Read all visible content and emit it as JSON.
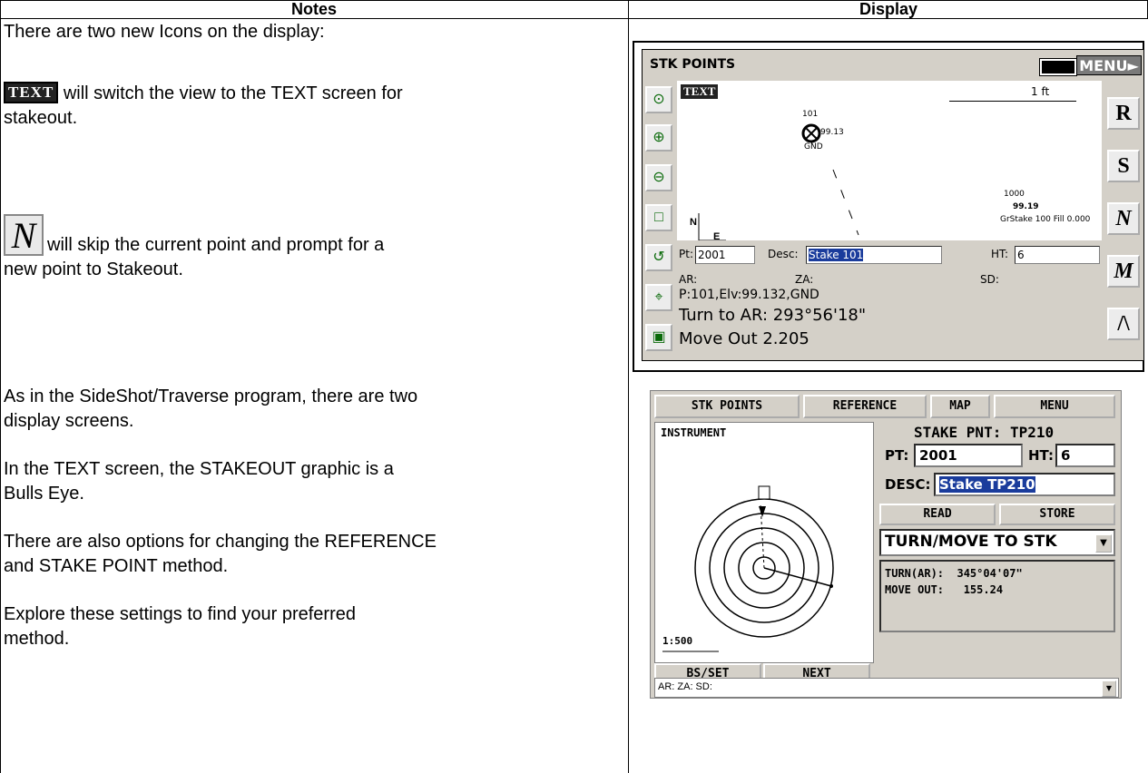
{
  "table": {
    "col_notes": "Notes",
    "col_display": "Display"
  },
  "notes": {
    "line1": "There are two new Icons on the display:",
    "text_icon_label": "TEXT",
    "text_desc_1": " will switch the view to the TEXT screen for",
    "text_desc_2": "stakeout.",
    "n_icon_label": "N",
    "n_desc_1": "will skip the current point and prompt for a",
    "n_desc_2": "new point to Stakeout.",
    "para2_1": "As in the SideShot/Traverse program, there are two",
    "para2_2": "display screens.",
    "para3_1": "In the TEXT screen, the STAKEOUT graphic is a",
    "para3_2": "Bulls Eye.",
    "para4_1": "There are also options for changing the REFERENCE",
    "para4_2": "and STAKE POINT method.",
    "para5_1": "Explore these settings to find your preferred",
    "para5_2": "method."
  },
  "screen1": {
    "title": "STK POINTS",
    "menu": "MENU",
    "text_tab": "TEXT",
    "scale": "1 ft",
    "pt101_label": "101",
    "pt101_elev": "99.13",
    "pt101_desc": "GND",
    "pt_label": "1000",
    "pt_elev": "99.19",
    "pt_info": "GrStake 100 Fill 0.000",
    "north": "N",
    "east": "E",
    "right_buttons": [
      "R",
      "S",
      "N",
      "M",
      "/\\"
    ],
    "pt_label_text": "Pt:",
    "pt_value": "2001",
    "desc_label": "Desc:",
    "desc_value": "Stake 101",
    "ht_label": "HT:",
    "ht_value": "6",
    "ar_label": "AR:",
    "za_label": "ZA:",
    "sd_label": "SD:",
    "point_info": "P:101,Elv:99.132,GND",
    "turn": "Turn to AR: 293°56'18\"",
    "move": "Move Out 2.205"
  },
  "screen2": {
    "tab_stk": "STK POINTS",
    "tab_ref": "REFERENCE",
    "tab_map": "MAP",
    "tab_menu": "MENU",
    "instrument": "INSTRUMENT",
    "scale": "1:500",
    "title": "STAKE PNT: TP210",
    "pt_label": "PT:",
    "pt_value": "2001",
    "ht_label": "HT:",
    "ht_value": "6",
    "desc_label": "DESC:",
    "desc_value": "Stake TP210",
    "read": "READ",
    "store": "STORE",
    "dropdown": "TURN/MOVE TO STK",
    "turn": "TURN(AR):  345°04'07\"",
    "move": "MOVE OUT:   155.24",
    "bs_set": "BS/SET",
    "next": "NEXT",
    "status": "AR: ZA: SD:"
  }
}
